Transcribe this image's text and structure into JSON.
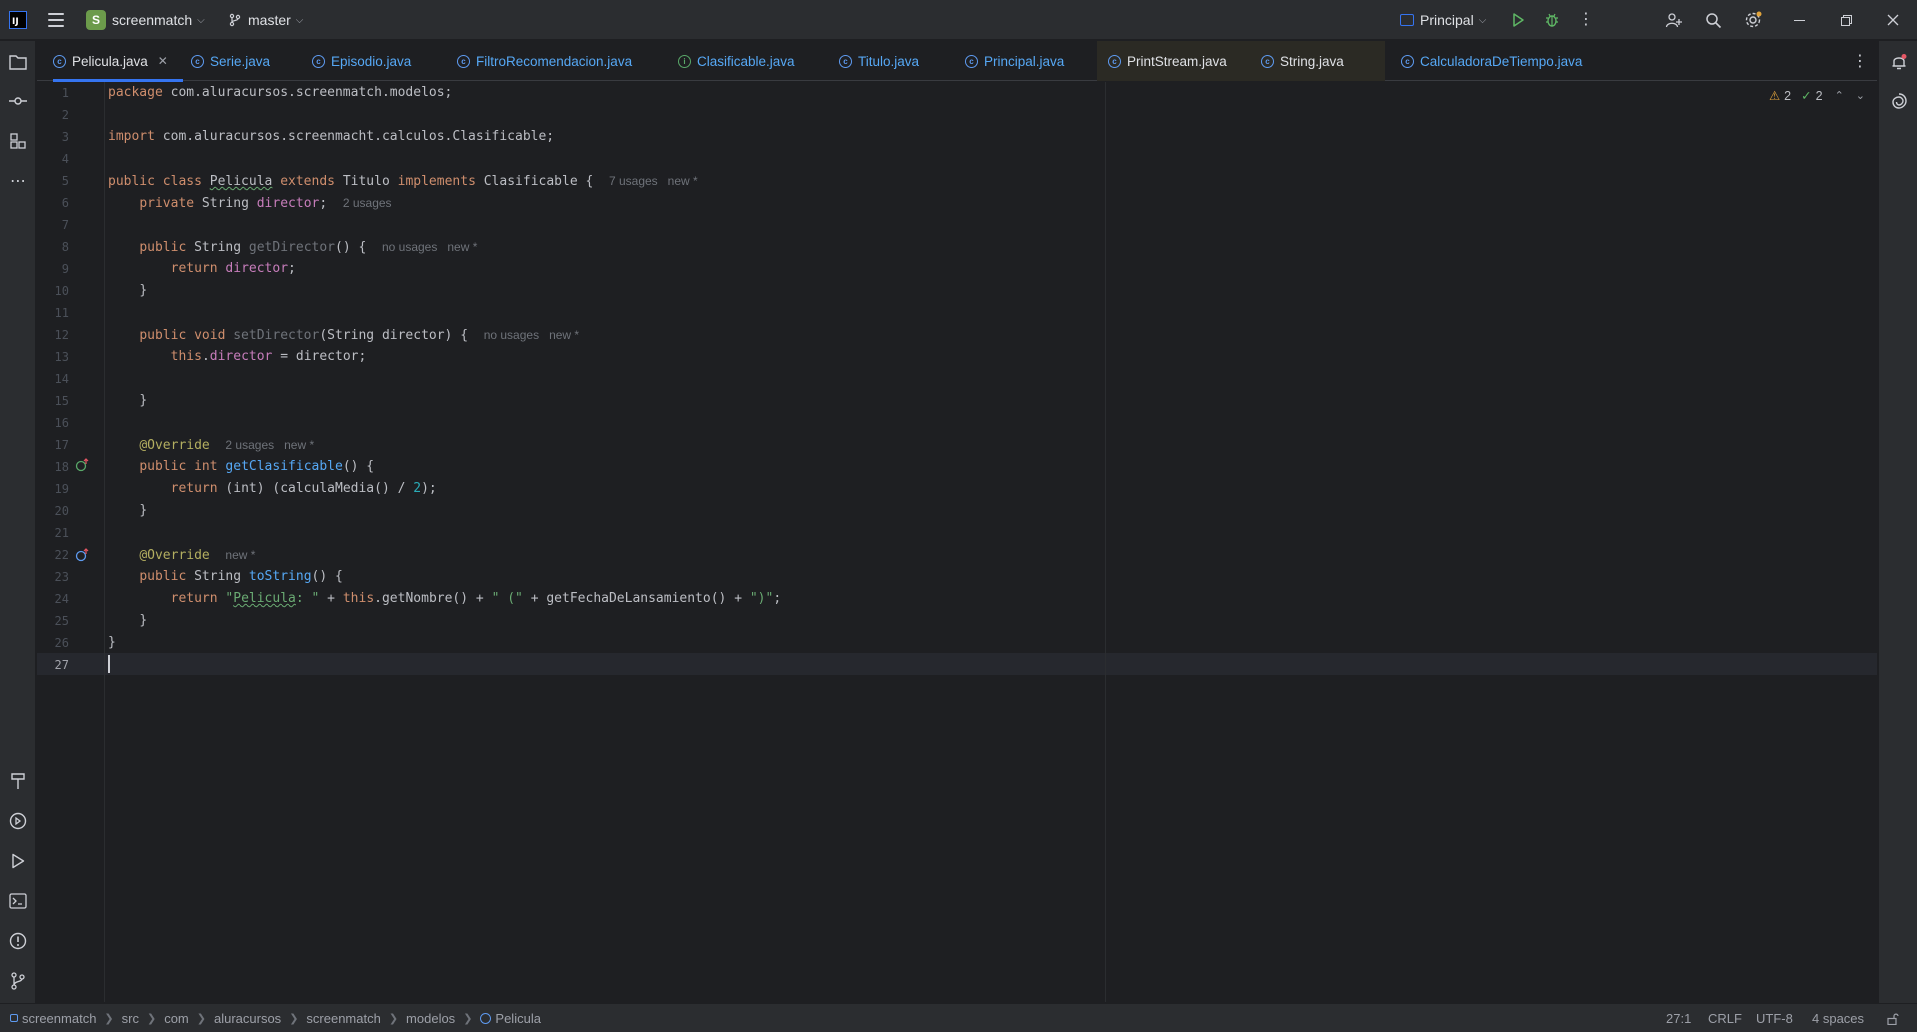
{
  "titlebar": {
    "project_initial": "S",
    "project_name": "screenmatch",
    "branch": "master",
    "run_config": "Principal"
  },
  "tabs": [
    {
      "label": "Pelicula.java",
      "active": true
    },
    {
      "label": "Serie.java"
    },
    {
      "label": "Episodio.java"
    },
    {
      "label": "FiltroRecomendacion.java"
    },
    {
      "label": "Clasificable.java"
    },
    {
      "label": "Titulo.java"
    },
    {
      "label": "Principal.java"
    },
    {
      "label": "PrintStream.java"
    },
    {
      "label": "String.java"
    },
    {
      "label": "CalculadoraDeTiempo.java"
    }
  ],
  "inspections": {
    "warnings": "2",
    "weak_warnings": "2"
  },
  "editor": {
    "line_numbers": [
      "1",
      "2",
      "3",
      "4",
      "5",
      "6",
      "7",
      "8",
      "9",
      "10",
      "11",
      "12",
      "13",
      "14",
      "15",
      "16",
      "17",
      "18",
      "19",
      "20",
      "21",
      "22",
      "23",
      "24",
      "25",
      "26",
      "27"
    ],
    "current_line": "27",
    "code": {
      "l1_kw": "package",
      "l1_rest": " com.aluracursos.screenmatch.modelos;",
      "l3_kw": "import",
      "l3_rest": " com.aluracursos.screenmacht.calculos.Clasificable;",
      "l5_kw1": "public class",
      "l5_cls": "Pelicula",
      "l5_kw2": "extends",
      "l5_sup": "Titulo",
      "l5_kw3": "implements",
      "l5_ifc": "Clasificable {",
      "l5_hint": "7 usages   new *",
      "l6_kw": "private",
      "l6_type": " String ",
      "l6_fld": "director",
      "l6_end": ";",
      "l6_hint": "2 usages",
      "l8_kw": "public",
      "l8_type": " String ",
      "l8_fn": "getDirector",
      "l8_end": "() {",
      "l8_hint": "no usages   new *",
      "l9_kw": "return",
      "l9_fld": "director",
      "l9_end": ";",
      "l10": "}",
      "l12_kw": "public void",
      "l12_fn": "setDirector",
      "l12_end": "(String director) {",
      "l12_hint": "no usages   new *",
      "l13_kw": "this",
      "l13_dot": ".",
      "l13_fld": "director",
      "l13_end": " = director;",
      "l15": "}",
      "l17_ann": "@Override",
      "l17_hint": "2 usages   new *",
      "l18_kw": "public int",
      "l18_fn": "getClasificable",
      "l18_end": "() {",
      "l19_kw": "return",
      "l19_mid": " (int) (calculaMedia() / ",
      "l19_num": "2",
      "l19_end": ");",
      "l20": "}",
      "l22_ann": "@Override",
      "l22_hint": "new *",
      "l23_kw": "public",
      "l23_type": " String ",
      "l23_fn": "toString",
      "l23_end": "() {",
      "l24_kw": "return",
      "l24_s1a": "\"",
      "l24_s1b": "Pelicula",
      "l24_s1c": ": \"",
      "l24_p1": " + ",
      "l24_this": "this",
      "l24_m1": ".getNombre() + ",
      "l24_s2": "\" (\"",
      "l24_m2": " + getFechaDeLansamiento() + ",
      "l24_s3": "\")\"",
      "l24_end": ";",
      "l25": "}",
      "l26": "}"
    }
  },
  "statusbar": {
    "breadcrumbs": [
      "screenmatch",
      "src",
      "com",
      "aluracursos",
      "screenmatch",
      "modelos",
      "Pelicula"
    ],
    "position": "27:1",
    "line_ending": "CRLF",
    "encoding": "UTF-8",
    "indent": "4 spaces"
  },
  "colors": {
    "accent": "#3574f0",
    "background": "#1e1f22",
    "panel": "#2b2d30",
    "keyword": "#cf8e6d",
    "field": "#c77dbb",
    "method": "#56a8f5",
    "string": "#6aab73",
    "annotation": "#b3ae60"
  }
}
